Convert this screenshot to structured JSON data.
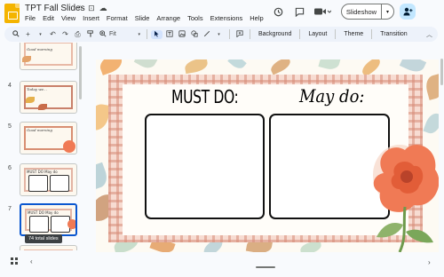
{
  "app": {
    "title": "TPT Fall Slides",
    "menu": [
      "File",
      "Edit",
      "View",
      "Insert",
      "Format",
      "Slide",
      "Arrange",
      "Tools",
      "Extensions",
      "Help"
    ],
    "title_icons": [
      "star-icon",
      "move-to-folder-icon",
      "cloud-status-icon"
    ]
  },
  "header_actions": {
    "history_icon": "↺",
    "comment_icon": "▢",
    "camera_icon": "■",
    "slideshow_label": "Slideshow",
    "slideshow_dropdown": "▾",
    "share_icon": "+"
  },
  "toolbar": {
    "icons": {
      "search": "🔍",
      "new_slide": "+",
      "undo": "↶",
      "redo": "↷",
      "print": "⎙",
      "paint_format": "⚲",
      "zoom": "⊕"
    },
    "zoom_value": "Fit",
    "tools": [
      "select",
      "textbox",
      "image",
      "shape",
      "line",
      "comment"
    ],
    "background_label": "Background",
    "layout_label": "Layout",
    "theme_label": "Theme",
    "transition_label": "Transition"
  },
  "filmstrip": {
    "slides": [
      {
        "number": "",
        "title": "Good morning"
      },
      {
        "number": "4",
        "title": "Today we..."
      },
      {
        "number": "5",
        "title": "Good morning"
      },
      {
        "number": "6",
        "title": "MUST DO   May do"
      },
      {
        "number": "7",
        "title": "MUST DO   May do"
      }
    ],
    "selected_index": 4,
    "tooltip": "74 total slides"
  },
  "slide": {
    "must_do_label": "MUST DO:",
    "may_do_label": "May do:"
  },
  "colors": {
    "accent_blue": "#0b57d0",
    "share_bg": "#c2e7ff",
    "gingham": "#d68c78",
    "flower": "#f07a55"
  },
  "bottom_bar": {
    "grid_view_icon": "grid-icon",
    "collapse_filmstrip_icon": "chevron-left-icon",
    "expand_panel_icon": "chevron-right-icon"
  }
}
